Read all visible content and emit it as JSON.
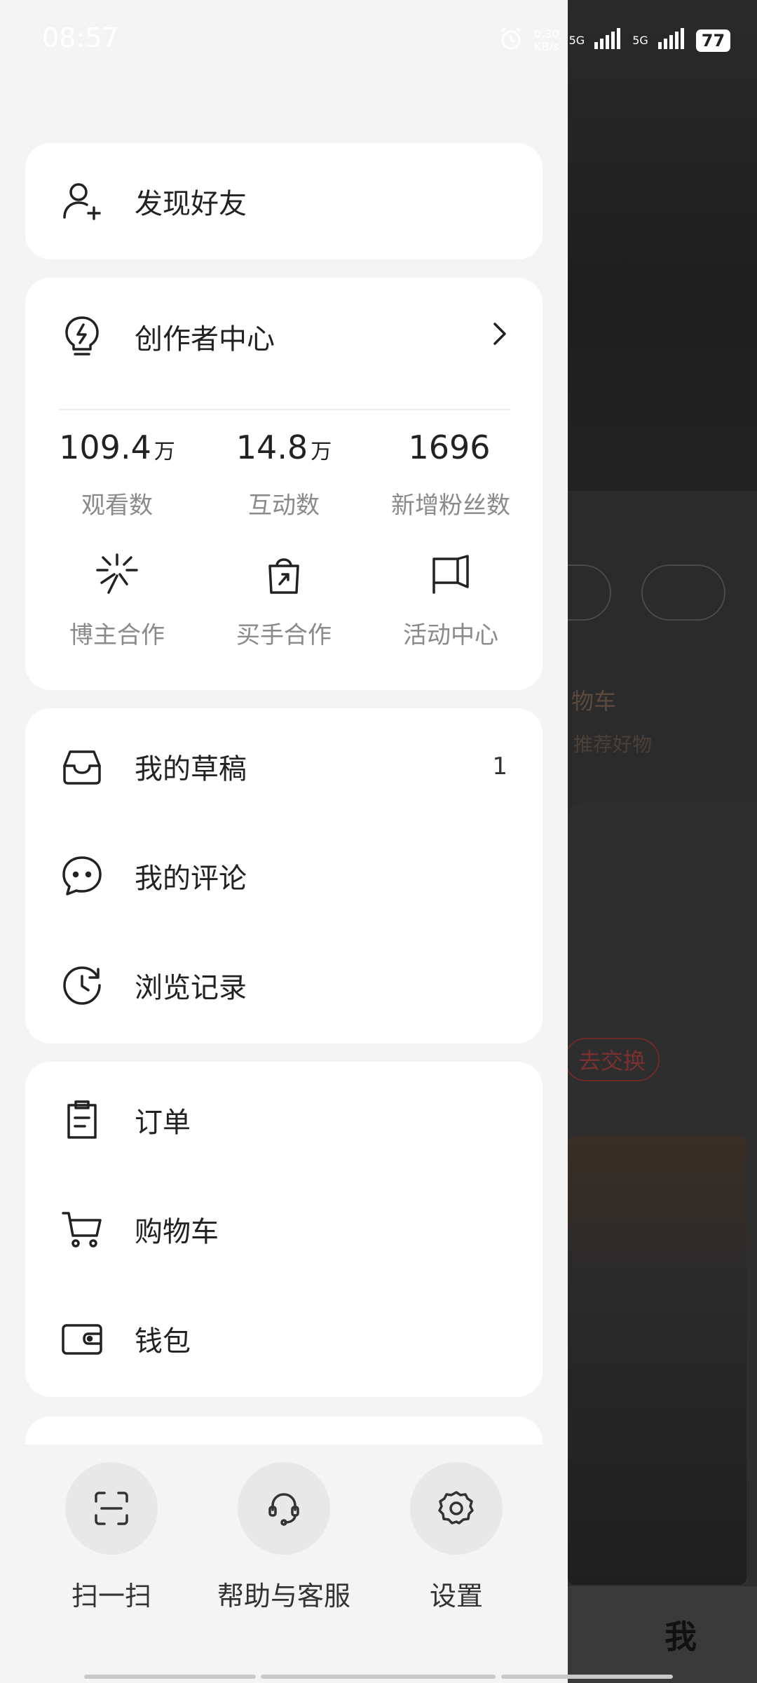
{
  "status_bar": {
    "time": "08:57",
    "network_speed_value": "0.30",
    "network_speed_unit": "KB/s",
    "signal_1": "5G",
    "signal_2": "5G",
    "battery": "77"
  },
  "drawer": {
    "find_friends": "发现好友",
    "creator_center": {
      "title": "创作者中心",
      "stats": [
        {
          "value": "109.4",
          "unit": "万",
          "label": "观看数"
        },
        {
          "value": "14.8",
          "unit": "万",
          "label": "互动数"
        },
        {
          "value": "1696",
          "unit": "",
          "label": "新增粉丝数"
        }
      ],
      "tools": [
        {
          "label": "博主合作",
          "icon": "sparkle-icon"
        },
        {
          "label": "买手合作",
          "icon": "shopping-bag-icon"
        },
        {
          "label": "活动中心",
          "icon": "flag-icon"
        }
      ]
    },
    "content_section": [
      {
        "label": "我的草稿",
        "icon": "inbox-icon",
        "count": "1"
      },
      {
        "label": "我的评论",
        "icon": "comment-icon"
      },
      {
        "label": "浏览记录",
        "icon": "history-icon"
      }
    ],
    "commerce_section": [
      {
        "label": "订单",
        "icon": "clipboard-icon"
      },
      {
        "label": "购物车",
        "icon": "cart-icon"
      },
      {
        "label": "钱包",
        "icon": "wallet-icon"
      }
    ],
    "bottom_actions": [
      {
        "label": "扫一扫",
        "icon": "scan-icon"
      },
      {
        "label": "帮助与客服",
        "icon": "headset-icon"
      },
      {
        "label": "设置",
        "icon": "settings-icon"
      }
    ]
  },
  "background": {
    "cart_label": "物车",
    "cart_sub": "推荐好物",
    "exchange_button": "去交换",
    "tab_me": "我"
  }
}
